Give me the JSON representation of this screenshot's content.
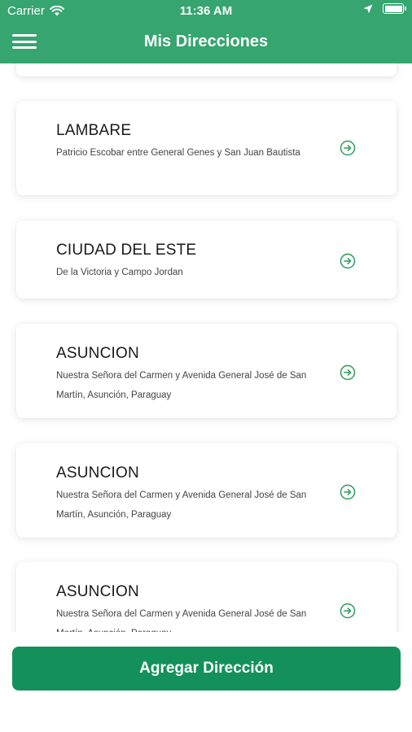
{
  "status_bar": {
    "carrier": "Carrier",
    "time": "11:36 AM",
    "icons": [
      "wifi-icon",
      "location-arrow-icon",
      "battery-icon"
    ]
  },
  "nav": {
    "title": "Mis Direcciones",
    "menu_icon": "hamburger-menu-icon"
  },
  "addresses": [
    {
      "city": "",
      "address": ""
    },
    {
      "city": "LAMBARE",
      "address": "Patricio Escobar entre General Genes y San Juan Bautista"
    },
    {
      "city": "CIUDAD DEL ESTE",
      "address": "De la Victoria y Campo Jordan"
    },
    {
      "city": "ASUNCION",
      "address": "Nuestra Señora del Carmen y Avenida General José de San Martín, Asunción, Paraguay"
    },
    {
      "city": "ASUNCION",
      "address": "Nuestra Señora del Carmen y Avenida General José de San Martín, Asunción, Paraguay"
    },
    {
      "city": "ASUNCION",
      "address": "Nuestra Señora del Carmen y Avenida General José de San Martín, Asunción, Paraguay"
    }
  ],
  "add_button_label": "Agregar Dirección",
  "colors": {
    "header": "#36a56f",
    "button": "#14915a",
    "icon": "#2e9a5f"
  }
}
